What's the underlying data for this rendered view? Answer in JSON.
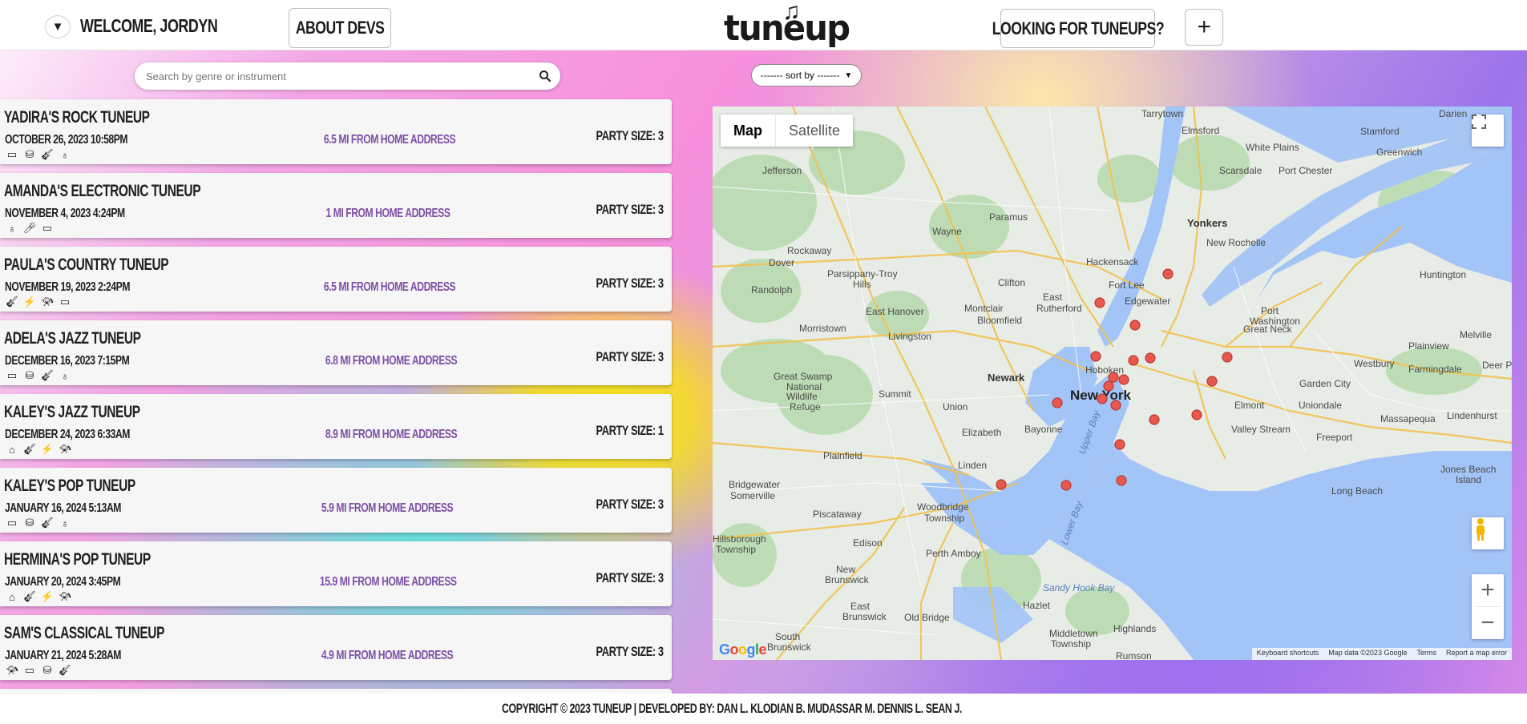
{
  "header": {
    "welcome": "Welcome, Jordyn",
    "toggle_icon": "▼",
    "about_label": "About Devs",
    "logo_text": "tuneup",
    "looking_label": "Looking for Tuneups?",
    "plus_label": "+"
  },
  "search": {
    "placeholder": "Search by genre or instrument"
  },
  "sort": {
    "label": "------- sort by -------"
  },
  "tuneups": [
    {
      "title": "Yadira's Rock Tuneup",
      "date": "October 26, 2023 10:58PM",
      "distance": "6.5 mi from home address",
      "party": "Party Size: 3",
      "icons": [
        "keyboard-icon",
        "drum-icon",
        "guitar-icon",
        "bass-icon"
      ]
    },
    {
      "title": "Amanda's Electronic Tuneup",
      "date": "November 4, 2023 4:24PM",
      "distance": "1 mi from home address",
      "party": "Party Size: 3",
      "icons": [
        "bass-icon",
        "microphone-icon",
        "synth-icon"
      ]
    },
    {
      "title": "Paula's Country Tuneup",
      "date": "November 19, 2023 2:24PM",
      "distance": "6.5 mi from home address",
      "party": "Party Size: 3",
      "icons": [
        "guitar-icon",
        "electric-guitar-icon",
        "trumpet-icon",
        "keyboard-icon"
      ]
    },
    {
      "title": "Adela's Jazz Tuneup",
      "date": "December 16, 2023 7:15PM",
      "distance": "6.8 mi from home address",
      "party": "Party Size: 3",
      "icons": [
        "keyboard-icon",
        "drum-icon",
        "guitar-icon",
        "bass-icon"
      ]
    },
    {
      "title": "Kaley's Jazz Tuneup",
      "date": "December 24, 2023 6:33AM",
      "distance": "8.9 mi from home address",
      "party": "Party Size: 1",
      "icons": [
        "piano-icon",
        "guitar-icon",
        "electric-guitar-icon",
        "trumpet-icon"
      ]
    },
    {
      "title": "Kaley's Pop Tuneup",
      "date": "January 16, 2024 5:13AM",
      "distance": "5.9 mi from home address",
      "party": "Party Size: 3",
      "icons": [
        "keyboard-icon",
        "drum-icon",
        "guitar-icon",
        "bass-icon"
      ]
    },
    {
      "title": "Hermina's Pop Tuneup",
      "date": "January 20, 2024 3:45PM",
      "distance": "15.9 mi from home address",
      "party": "Party Size: 3",
      "icons": [
        "piano-icon",
        "guitar-icon",
        "electric-guitar-icon",
        "trumpet-icon"
      ]
    },
    {
      "title": "Sam's Classical Tuneup",
      "date": "January 21, 2024 5:28AM",
      "distance": "4.9 mi from home address",
      "party": "Party Size: 3",
      "icons": [
        "trumpet-icon",
        "keyboard-icon",
        "drum-icon",
        "guitar-icon"
      ]
    }
  ],
  "map": {
    "map_tab": "Map",
    "satellite_tab": "Satellite",
    "google": "Google",
    "city_label": "New York",
    "place_labels": [
      "Tarrytown",
      "Elmsford",
      "White Plains",
      "Stamford",
      "Darien",
      "Greenwich",
      "Port Chester",
      "Scarsdale",
      "Jefferson",
      "Yonkers",
      "New Rochelle",
      "Paramus",
      "Wayne",
      "Rockaway",
      "Dover",
      "Parsippany-Troy Hills",
      "Hackensack",
      "Fort Lee",
      "Edgewater",
      "Randolph",
      "Clifton",
      "East Rutherford",
      "Montclair",
      "Bloomfield",
      "East Hanover",
      "Morristown",
      "Livingston",
      "Newark",
      "Hoboken",
      "Summit",
      "Union",
      "Elizabeth",
      "Bayonne",
      "Great Swamp National Wildlife Refuge",
      "Plainfield",
      "Linden",
      "Bridgewater",
      "Somerville",
      "Piscataway",
      "Woodbridge Township",
      "Edison",
      "Perth Amboy",
      "Hillsborough Township",
      "New Brunswick",
      "East Brunswick",
      "South Brunswick Township",
      "Old Bridge",
      "Middletown Township",
      "Hazlet",
      "Rumson",
      "Highlands",
      "Sandy Hook Bay",
      "Lower Bay",
      "Upper Bay",
      "Port Washington",
      "Great Neck",
      "Huntington",
      "Plainview",
      "Melville",
      "Westbury",
      "Farmingdale",
      "Garden City",
      "Elmont",
      "Uniondale",
      "Valley Stream",
      "Freeport",
      "Massapequa",
      "Lindenhurst",
      "Long Beach",
      "Jones Beach Island",
      "Deer Pa"
    ],
    "keyboard_shortcuts": "Keyboard shortcuts",
    "map_data": "Map data ©2023 Google",
    "terms": "Terms",
    "report": "Report a map error"
  },
  "footer": {
    "text": "Copyright © 2023 TuneUp | Developed by: Dan L. Klodian B. Mudassar M. Dennis L. Sean J."
  },
  "colors": {
    "accent_purple": "#7d4fa6",
    "map_water": "#a3c4f7",
    "marker": "#e8584f"
  }
}
